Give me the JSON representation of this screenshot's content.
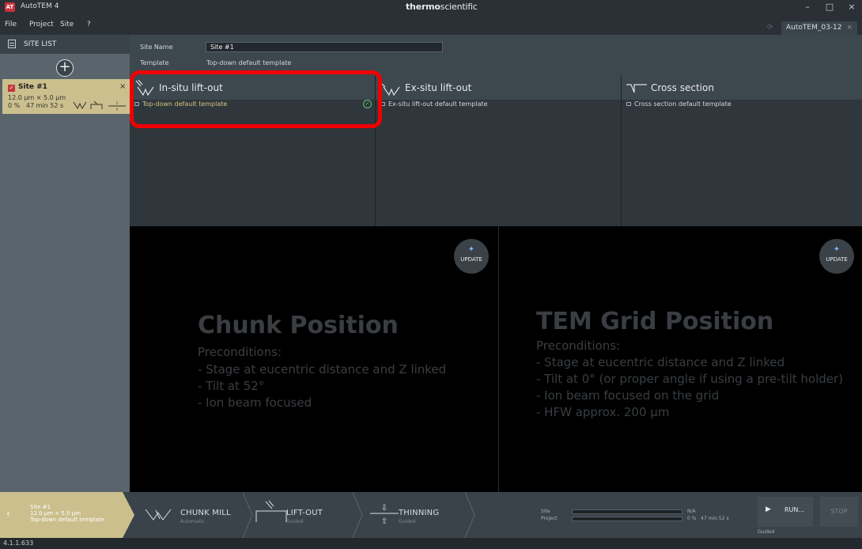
{
  "window": {
    "app_title": "AutoTEM 4",
    "logo_text": "AT",
    "brand_bold": "thermo",
    "brand_light": "scientific",
    "minimize": "–",
    "maximize": "□",
    "close": "×"
  },
  "menu": {
    "items": [
      "File",
      "Project",
      "Site",
      "?"
    ]
  },
  "project_tab": {
    "label": "AutoTEM_03-12",
    "close": "×"
  },
  "sidebar": {
    "header": "SITE LIST",
    "add_symbol": "+",
    "site": {
      "name": "Site #1",
      "dimensions": "12.0 µm × 5.0 µm",
      "progress": "0 %",
      "time": "47 min 52 s",
      "close": "×",
      "checked": true
    }
  },
  "site_info": {
    "name_label": "Site Name",
    "name_value": "Site #1",
    "template_label": "Template",
    "template_value": "Top-down default template"
  },
  "workflows": [
    {
      "title": "In-situ lift-out",
      "template": "Top-down default template",
      "selected": true
    },
    {
      "title": "Ex-situ lift-out",
      "template": "Ex-situ lift-out default template",
      "selected": false
    },
    {
      "title": "Cross section",
      "template": "Cross section default template",
      "selected": false
    }
  ],
  "panels": {
    "left": {
      "update": "UPDATE",
      "title": "Chunk Position",
      "lines": [
        "Preconditions:",
        "- Stage at eucentric distance and Z linked",
        "- Tilt at 52°",
        "- Ion beam focused"
      ]
    },
    "right": {
      "update": "UPDATE",
      "title": "TEM Grid Position",
      "lines": [
        "Preconditions:",
        "- Stage at eucentric distance and Z linked",
        "- Tilt at 0° (or proper angle if using a pre-tilt holder)",
        "- Ion beam focused on the grid",
        "- HFW approx. 200 µm"
      ]
    }
  },
  "bottom": {
    "site_name": "Site #1",
    "site_dim": "12.0 µm × 5.0 µm",
    "site_template": "Top-down default template",
    "steps": [
      {
        "name": "CHUNK MILL",
        "sub": "Automatic"
      },
      {
        "name": "LIFT-OUT",
        "sub": "Guided"
      },
      {
        "name": "THINNING",
        "sub": "Guided"
      }
    ],
    "progress": {
      "site_label": "Site",
      "project_label": "Project",
      "site_value": "N/A",
      "project_value": "0 %",
      "project_time": "47 min 52 s",
      "site_fraction": 0,
      "project_fraction": 0
    },
    "run_label": "RUN...",
    "run_mode": "Guided",
    "stop_label": "STOP"
  },
  "status": {
    "version": "4.1.1.633"
  },
  "colors": {
    "accent_site": "#cbbf8d",
    "highlight": "#f00000",
    "check": "#5fc46b",
    "logo": "#c8323a"
  }
}
